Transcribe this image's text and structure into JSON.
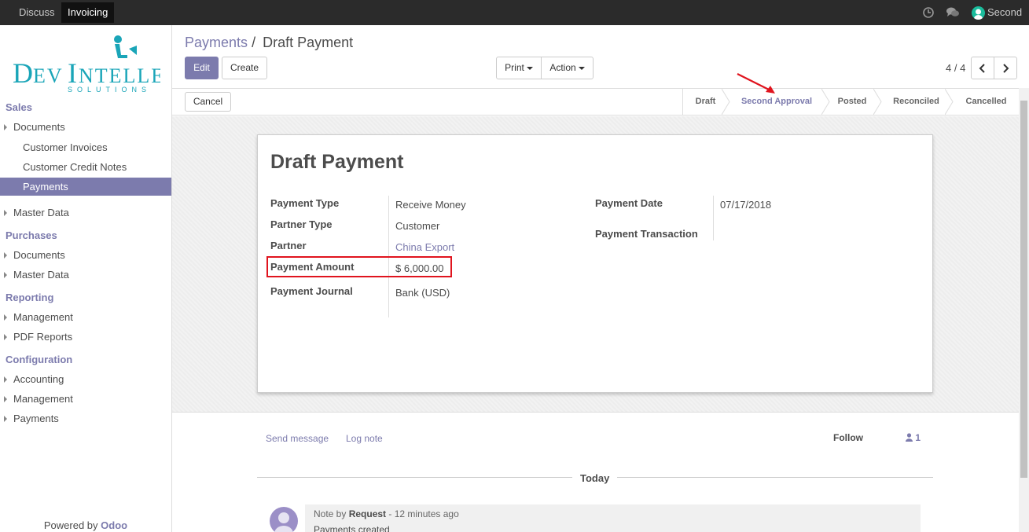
{
  "topbar": {
    "apps": [
      "Discuss",
      "Invoicing"
    ],
    "user_name": "Second",
    "icons": [
      "clock-icon",
      "chat-icon"
    ]
  },
  "sidebar": {
    "logo_main": "DevIntelle",
    "logo_sub": "SOLUTIONS",
    "sections": [
      {
        "title": "Sales",
        "items": [
          "Documents",
          "Customer Invoices",
          "Customer Credit Notes",
          "Payments",
          "Master Data"
        ]
      },
      {
        "title": "Purchases",
        "items": [
          "Documents",
          "Master Data"
        ]
      },
      {
        "title": "Reporting",
        "items": [
          "Management",
          "PDF Reports"
        ]
      },
      {
        "title": "Configuration",
        "items": [
          "Accounting",
          "Management",
          "Payments"
        ]
      }
    ],
    "powered_by": "Powered by",
    "powered_brand": "Odoo"
  },
  "breadcrumb": {
    "parent": "Payments",
    "separator": "/",
    "current": "Draft Payment"
  },
  "buttons": {
    "edit": "Edit",
    "create": "Create",
    "print": "Print",
    "action": "Action",
    "cancel": "Cancel"
  },
  "pager": {
    "value": "4 / 4"
  },
  "stages": [
    "Draft",
    "Second Approval",
    "Posted",
    "Reconciled",
    "Cancelled"
  ],
  "active_stage": "Second Approval",
  "form": {
    "title": "Draft Payment",
    "left": [
      {
        "label": "Payment Type",
        "value": "Receive Money"
      },
      {
        "label": "Partner Type",
        "value": "Customer"
      },
      {
        "label": "Partner",
        "value": "China Export"
      },
      {
        "label": "Payment Amount",
        "value": "$ 6,000.00"
      },
      {
        "label": "Payment Journal",
        "value": "Bank (USD)"
      }
    ],
    "right": [
      {
        "label": "Payment Date",
        "value": "07/17/2018"
      },
      {
        "label": "Payment Transaction",
        "value": ""
      }
    ]
  },
  "chatter": {
    "send_message": "Send message",
    "log_note": "Log note",
    "follow": "Follow",
    "followers_count": "1",
    "date_separator": "Today",
    "message": {
      "prefix": "Note by",
      "author": "Request",
      "time": "- 12 minutes ago",
      "body": "Payments created"
    }
  },
  "colors": {
    "accent": "#7c7bad",
    "annotation": "#e0141e",
    "topbar": "#2b2b2b"
  }
}
